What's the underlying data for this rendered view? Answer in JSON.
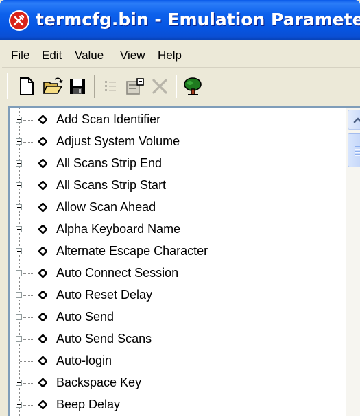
{
  "window": {
    "title": "termcfg.bin - Emulation Parameters",
    "icon": "app-wrench-icon"
  },
  "menu": {
    "items": [
      {
        "label": "File",
        "hotkey": "F"
      },
      {
        "label": "Edit",
        "hotkey": "E"
      },
      {
        "label": "Value",
        "hotkey": "V"
      },
      {
        "label": "View",
        "hotkey": "V"
      },
      {
        "label": "Help",
        "hotkey": "H"
      }
    ]
  },
  "toolbar": {
    "buttons": [
      {
        "name": "new-document",
        "icon": "new-document-icon",
        "enabled": true
      },
      {
        "name": "open-folder",
        "icon": "open-folder-icon",
        "enabled": true
      },
      {
        "name": "save",
        "icon": "save-disk-icon",
        "enabled": true
      },
      {
        "name": "list",
        "icon": "list-icon",
        "enabled": false
      },
      {
        "name": "properties",
        "icon": "properties-icon",
        "enabled": false
      },
      {
        "name": "delete",
        "icon": "delete-x-icon",
        "enabled": false
      },
      {
        "name": "tree",
        "icon": "tree-icon",
        "enabled": true
      }
    ]
  },
  "tree": {
    "nodes": [
      {
        "label": "Add Scan Identifier",
        "expandable": true
      },
      {
        "label": "Adjust System Volume",
        "expandable": true
      },
      {
        "label": "All Scans Strip End",
        "expandable": true
      },
      {
        "label": "All Scans Strip Start",
        "expandable": true
      },
      {
        "label": "Allow Scan Ahead",
        "expandable": true
      },
      {
        "label": "Alpha Keyboard Name",
        "expandable": true
      },
      {
        "label": "Alternate Escape Character",
        "expandable": true
      },
      {
        "label": "Auto Connect Session",
        "expandable": true
      },
      {
        "label": "Auto Reset Delay",
        "expandable": true
      },
      {
        "label": "Auto Send",
        "expandable": true
      },
      {
        "label": "Auto Send Scans",
        "expandable": true
      },
      {
        "label": "Auto-login",
        "expandable": false
      },
      {
        "label": "Backspace Key",
        "expandable": true
      },
      {
        "label": "Beep Delay",
        "expandable": true
      }
    ]
  },
  "colors": {
    "title_bar": "#0655e2",
    "window_face": "#ece9d8",
    "tree_background": "#ffffff",
    "tree_border": "#7f9db9"
  }
}
